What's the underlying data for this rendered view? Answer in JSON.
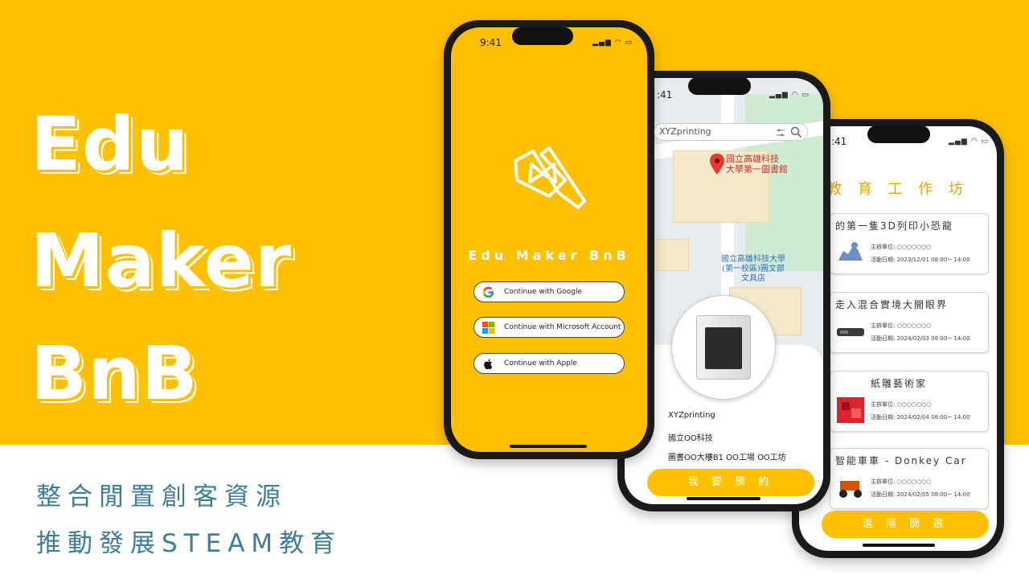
{
  "hero": {
    "line1": "Edu",
    "line2": "Maker",
    "line3": "BnB",
    "slogan1": "整合閒置創客資源",
    "slogan2": "推動發展STEAM教育"
  },
  "colors": {
    "brand_yellow": "#FFC000",
    "slogan_teal": "#3E7D95",
    "title_orange": "#E8A600"
  },
  "login_screen": {
    "status_time": "9:41",
    "brand_name": "Edu Maker BnB",
    "buttons": [
      {
        "label": "Continue with Google",
        "icon": "google-icon"
      },
      {
        "label": "Continue with Microsoft Account",
        "icon": "microsoft-icon"
      },
      {
        "label": "Continue with Apple",
        "icon": "apple-icon"
      }
    ]
  },
  "map_screen": {
    "status_time": ":41",
    "search_text": "XYZprinting",
    "pin_label": "國立高雄科技\n大學第一圖書館",
    "campus_label": "國立高雄科技大學\n(第一校區)圖文部\n文具店",
    "detail": {
      "brand": "XYZprinting",
      "org": "國立OO科技",
      "location": "圖書OO大樓B1 OO工場 OO工坊"
    },
    "book_button": "我 要 預 約"
  },
  "workshop_screen": {
    "status_time": ":41",
    "title": "教 育 工 作 坊",
    "cards": [
      {
        "name": "的第一隻3D列印小恐龍",
        "org": "主辦單位: ○○○○○○○",
        "date": "活動日期: 2023/12/01 08:00~ 14:00"
      },
      {
        "name": "走入混合實境大開眼界",
        "org": "主辦單位: ○○○○○○○",
        "date": "活動日期: 2024/02/03 08:00~ 14:00"
      },
      {
        "name": "紙雕藝術家",
        "org": "主辦單位: ○○○○○○○",
        "date": "活動日期: 2024/02/04 08:00~ 14:00"
      },
      {
        "name": "智能車車 - Donkey Car",
        "org": "主辦單位: ○○○○○○○",
        "date": "活動日期: 2024/02/05 08:00~ 14:00"
      }
    ],
    "filter_button": "進 階 篩 選"
  }
}
